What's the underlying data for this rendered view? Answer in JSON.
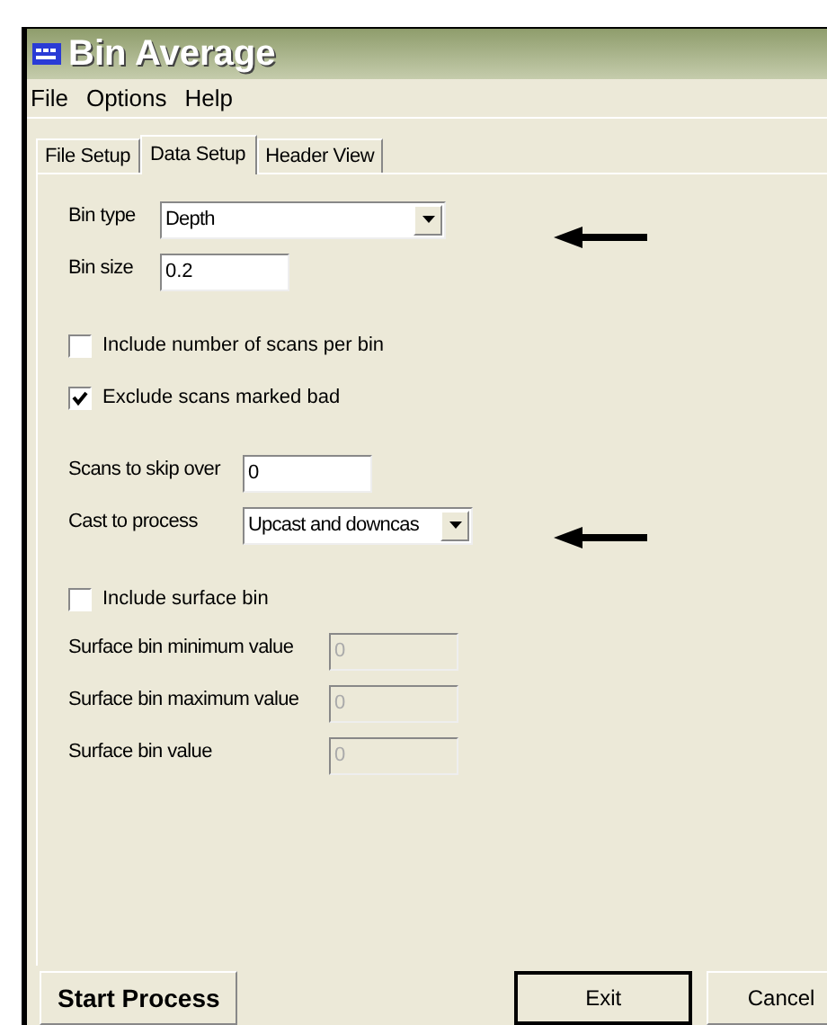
{
  "window": {
    "title": "Bin Average"
  },
  "menu": [
    "File",
    "Options",
    "Help"
  ],
  "tabs": [
    {
      "label": "File Setup",
      "selected": false
    },
    {
      "label": "Data Setup",
      "selected": true
    },
    {
      "label": "Header View",
      "selected": false
    }
  ],
  "sections": [
    [
      {
        "kind": "dropdown",
        "label": "Bin type",
        "value": "Depth",
        "pointer_arrow": true
      },
      {
        "kind": "field",
        "label": "Bin size",
        "value": "0.2",
        "disabled": false
      }
    ],
    [
      {
        "kind": "checkbox",
        "label": "Include number of scans per bin",
        "checked": false
      },
      {
        "kind": "checkbox",
        "label": "Exclude scans marked bad",
        "checked": true
      }
    ],
    [
      {
        "kind": "field",
        "label": "Scans to skip over",
        "value": "0",
        "disabled": false
      },
      {
        "kind": "dropdown",
        "label": "Cast to process",
        "value": "Upcast and downcas",
        "pointer_arrow": true
      }
    ],
    [
      {
        "kind": "checkbox",
        "label": "Include surface bin",
        "checked": false
      },
      {
        "kind": "field",
        "label": "Surface bin minimum value",
        "value": "0",
        "disabled": true
      },
      {
        "kind": "field",
        "label": "Surface bin maximum value",
        "value": "0",
        "disabled": true
      },
      {
        "kind": "field",
        "label": "Surface bin value",
        "value": "0",
        "disabled": true
      }
    ]
  ],
  "buttons": {
    "start": "Start Process",
    "exit": "Exit",
    "cancel": "Cancel"
  }
}
